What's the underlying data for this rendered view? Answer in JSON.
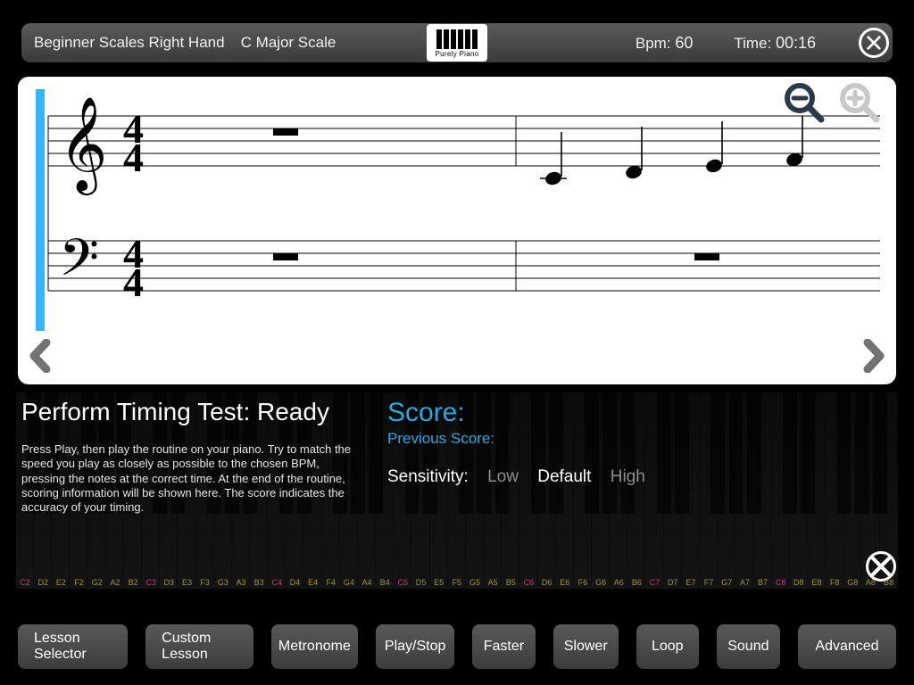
{
  "header": {
    "lesson_category": "Beginner Scales Right Hand",
    "lesson_name": "C Major Scale",
    "logo_text": "Purely Piano",
    "bpm_label": "Bpm:",
    "bpm_value": "60",
    "time_label": "Time:",
    "time_value": "00:16"
  },
  "info": {
    "status_title": "Perform Timing Test: Ready",
    "instructions": "Press Play, then play the routine on your piano. Try to match the speed you play as closely as possible to the chosen BPM, pressing the notes at the correct time. At the end of the routine, scoring information will be shown here. The score indicates the accuracy of your timing.",
    "score_label": "Score:",
    "previous_label": "Previous Score:",
    "sensitivity_label": "Sensitivity:",
    "sensitivity_options": {
      "low": "Low",
      "default": "Default",
      "high": "High"
    },
    "sensitivity_selected": "Default"
  },
  "buttons": {
    "lesson_selector": "Lesson Selector",
    "custom_lesson": "Custom Lesson",
    "metronome": "Metronome",
    "play_stop": "Play/Stop",
    "faster": "Faster",
    "slower": "Slower",
    "loop": "Loop",
    "sound": "Sound",
    "advanced": "Advanced"
  },
  "chart_data": {
    "type": "table",
    "description": "Grand staff, 4/4 time, two measures shown. Treble measure 1 is a whole rest; treble measure 2 ascends C4 D4 E4 F4 as quarter notes. Bass is whole rests in both measures.",
    "time_signature": "4/4",
    "measures": [
      {
        "treble": [
          "rest_whole"
        ],
        "bass": [
          "rest_whole"
        ]
      },
      {
        "treble": [
          "C4",
          "D4",
          "E4",
          "F4"
        ],
        "bass": [
          "rest_whole"
        ]
      }
    ]
  }
}
